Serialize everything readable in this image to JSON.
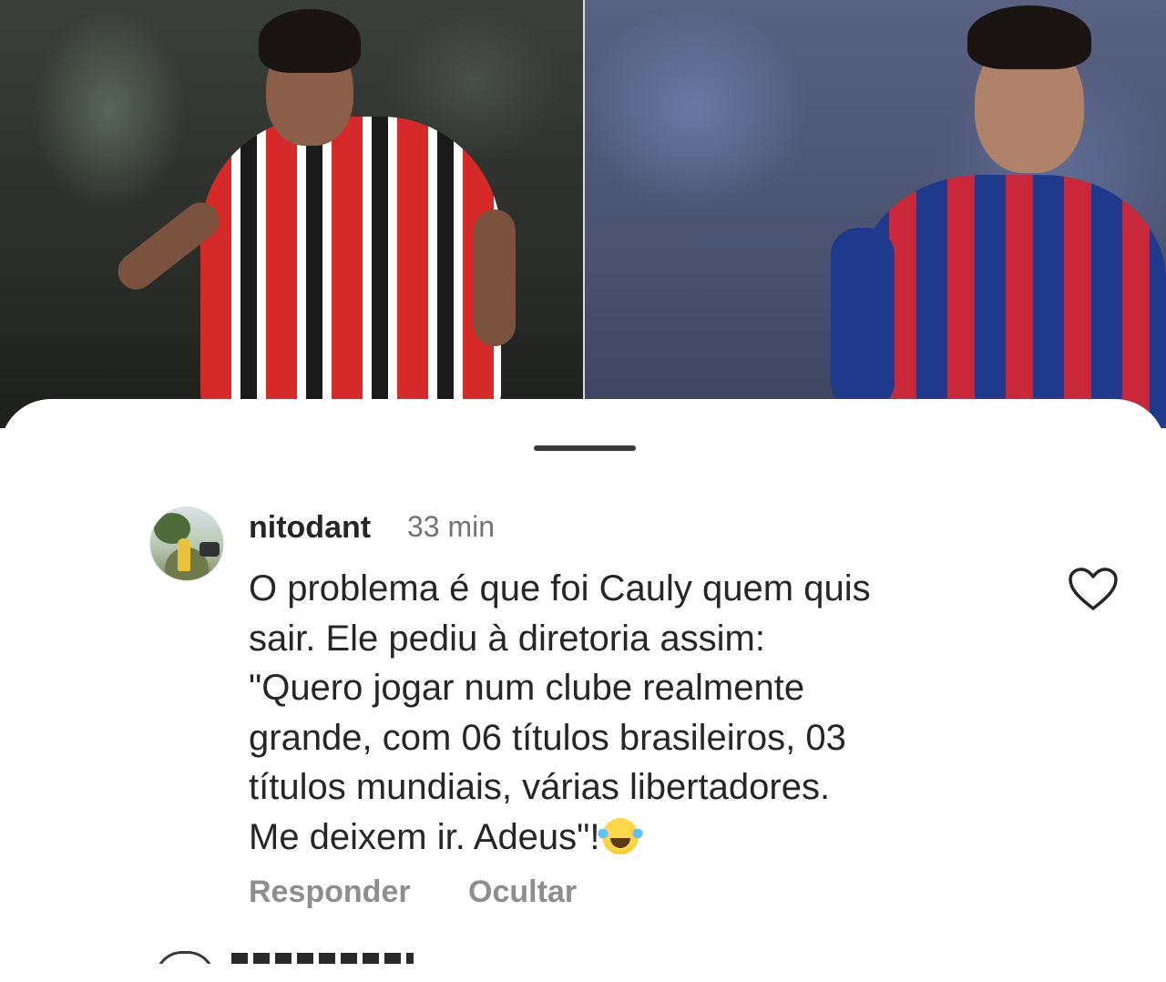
{
  "comment": {
    "username": "nitodant",
    "time": "33 min",
    "text": "O problema é que foi Cauly quem quis\nsair. Ele pediu à diretoria assim:\n\"Quero jogar num clube realmente\ngrande, com 06 títulos brasileiros, 03\ntítulos mundiais, várias libertadores.\nMe deixem ir. Adeus\"!",
    "emoji": "face-with-tears-of-joy",
    "actions": {
      "reply_label": "Responder",
      "hide_label": "Ocultar"
    },
    "like_icon": "heart-outline-icon"
  },
  "photos": {
    "left_kit_colors": [
      "#d62a2a",
      "#ffffff",
      "#1a1a1a"
    ],
    "right_kit_colors": [
      "#1f3a8c",
      "#c8283a"
    ]
  }
}
